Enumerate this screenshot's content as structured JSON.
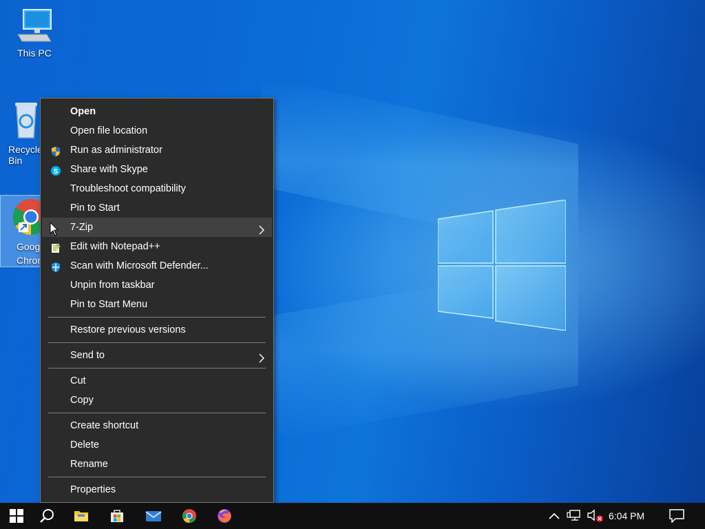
{
  "desktop": {
    "icons": [
      {
        "label": "This PC"
      },
      {
        "label": "Recycle Bin"
      },
      {
        "label": "Google Chrome"
      }
    ]
  },
  "context_menu": {
    "groups": [
      [
        {
          "label": "Open",
          "bold": true
        },
        {
          "label": "Open file location"
        },
        {
          "label": "Run as administrator",
          "icon": "uac-shield-icon"
        },
        {
          "label": "Share with Skype",
          "icon": "skype-icon"
        },
        {
          "label": "Troubleshoot compatibility"
        },
        {
          "label": "Pin to Start"
        },
        {
          "label": "7-Zip",
          "submenu": true,
          "highlighted": true
        },
        {
          "label": "Edit with Notepad++",
          "icon": "notepadpp-icon"
        },
        {
          "label": "Scan with Microsoft Defender...",
          "icon": "defender-icon"
        },
        {
          "label": "Unpin from taskbar"
        },
        {
          "label": "Pin to Start Menu"
        }
      ],
      [
        {
          "label": "Restore previous versions"
        }
      ],
      [
        {
          "label": "Send to",
          "submenu": true
        }
      ],
      [
        {
          "label": "Cut"
        },
        {
          "label": "Copy"
        }
      ],
      [
        {
          "label": "Create shortcut"
        },
        {
          "label": "Delete"
        },
        {
          "label": "Rename"
        }
      ],
      [
        {
          "label": "Properties"
        }
      ]
    ]
  },
  "taskbar": {
    "pinned": [
      "start-button",
      "search-icon",
      "file-explorer-icon",
      "microsoft-store-icon",
      "mail-icon",
      "chrome-icon",
      "firefox-icon"
    ],
    "clock": "6:04 PM"
  },
  "colors": {
    "menu_bg": "#2b2b2b",
    "menu_hover": "#414141",
    "taskbar_bg": "#101010",
    "desktop_blue": "#0a6ad6"
  }
}
